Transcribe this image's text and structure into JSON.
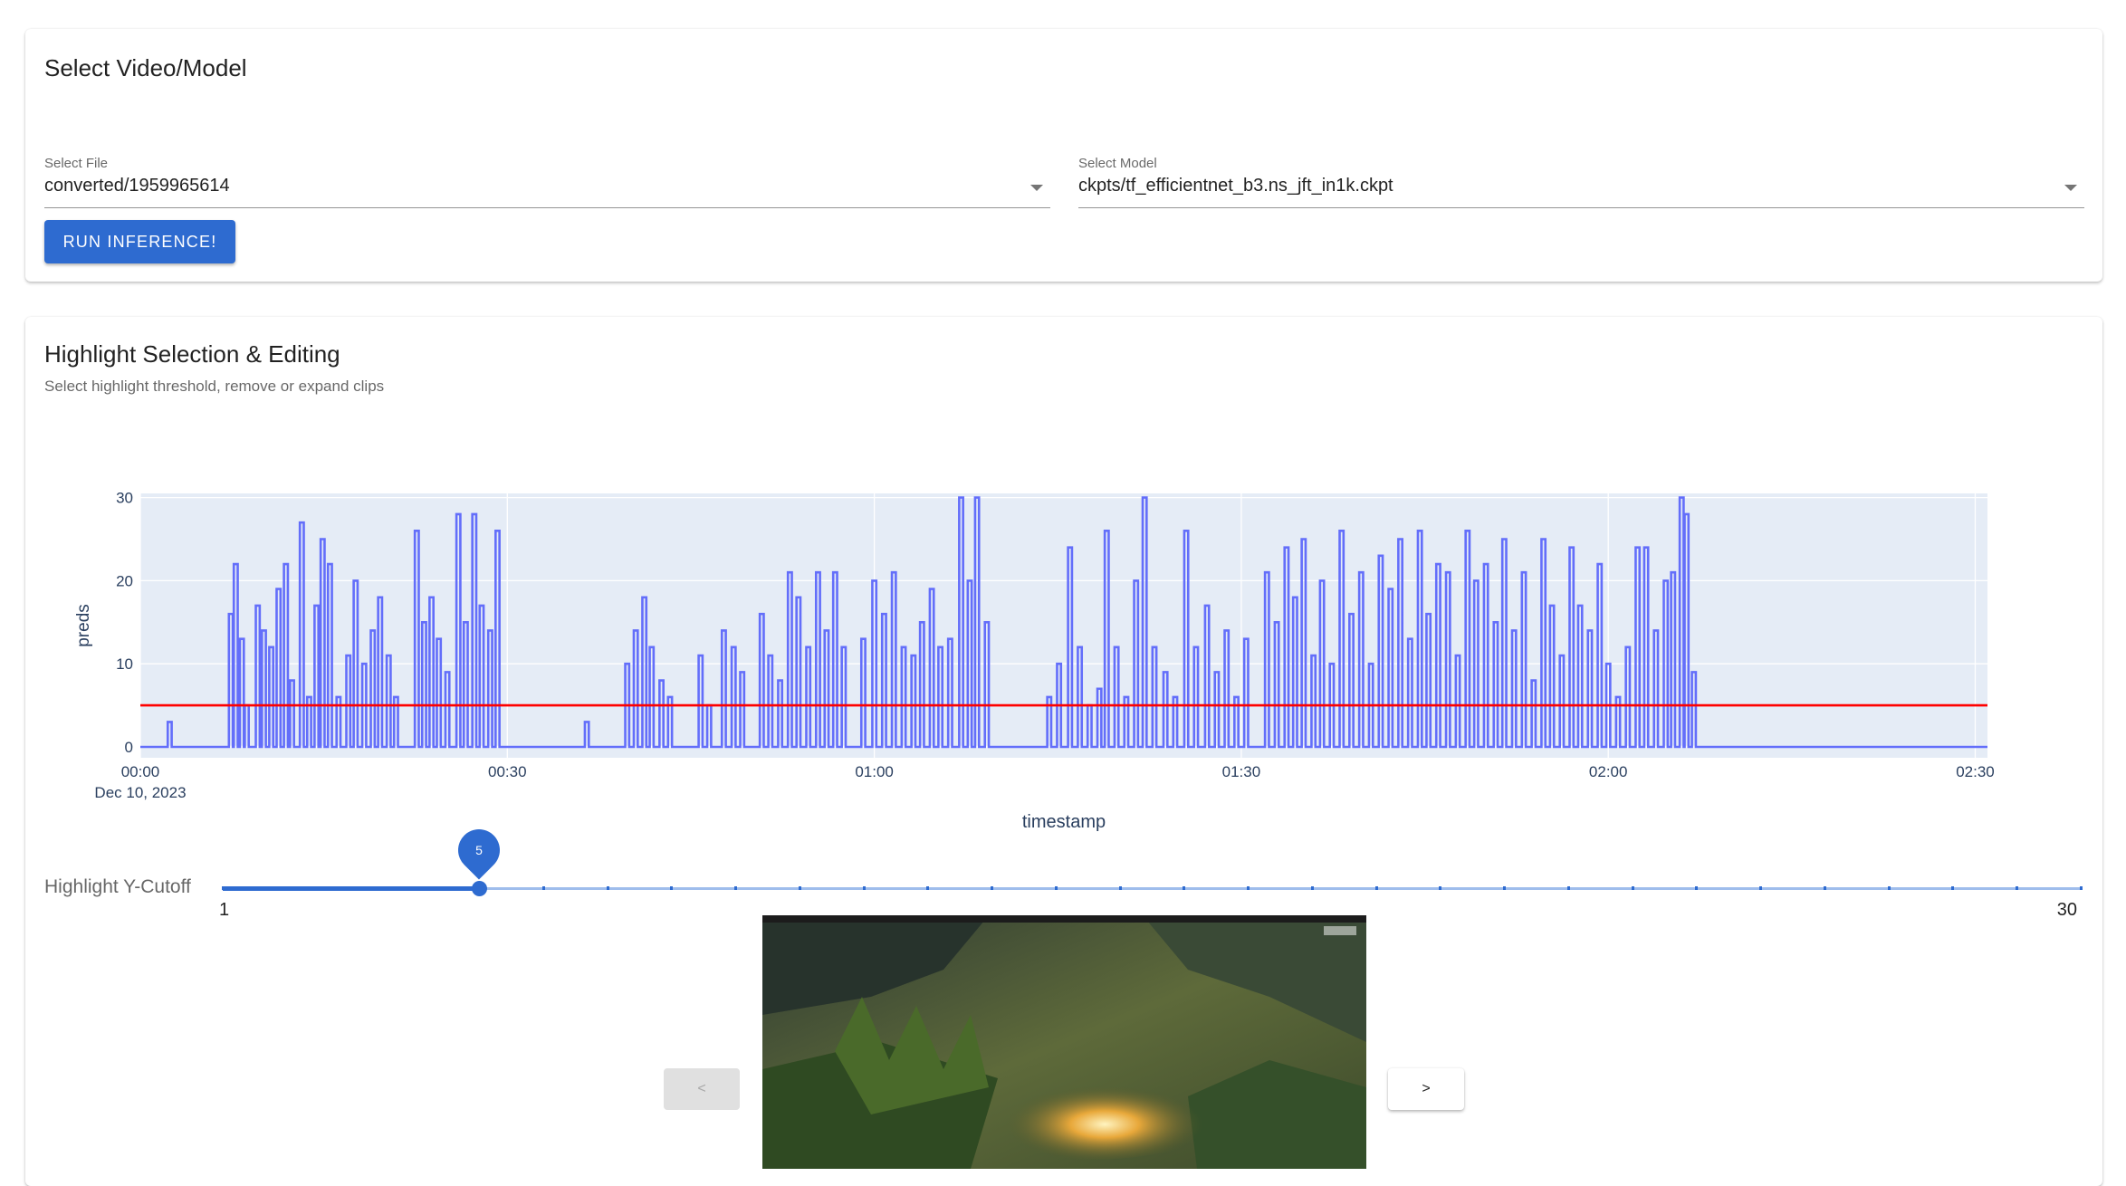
{
  "select_panel": {
    "title": "Select Video/Model",
    "file_label": "Select File",
    "file_value": "converted/1959965614",
    "model_label": "Select Model",
    "model_value": "ckpts/tf_efficientnet_b3.ns_jft_in1k.ckpt",
    "run_button": "RUN INFERENCE!"
  },
  "highlight_panel": {
    "title": "Highlight Selection & Editing",
    "subtitle": "Select highlight threshold, remove or expand clips",
    "slider_label": "Highlight Y-Cutoff",
    "slider_min": "1",
    "slider_max": "30",
    "slider_value": "5",
    "prev_button": "<",
    "next_button": ">"
  },
  "chart_data": {
    "type": "line",
    "title": "",
    "xlabel": "timestamp",
    "ylabel": "preds",
    "x_ticks": [
      "00:00",
      "00:30",
      "01:00",
      "01:30",
      "02:00",
      "02:30"
    ],
    "x_date_label": "Dec 10, 2023",
    "y_ticks": [
      "0",
      "10",
      "20",
      "30"
    ],
    "ylim": [
      0,
      30
    ],
    "xlim_seconds": [
      0,
      151
    ],
    "line_shape": "step",
    "series": [
      {
        "color": "#636efa",
        "peaks": [
          [
            2.4,
            3
          ],
          [
            7.4,
            16
          ],
          [
            7.8,
            22
          ],
          [
            8.3,
            13
          ],
          [
            8.7,
            5
          ],
          [
            9.6,
            17
          ],
          [
            10.1,
            14
          ],
          [
            10.7,
            12
          ],
          [
            11.3,
            19
          ],
          [
            11.9,
            22
          ],
          [
            12.4,
            8
          ],
          [
            13.2,
            27
          ],
          [
            13.8,
            6
          ],
          [
            14.4,
            17
          ],
          [
            14.9,
            25
          ],
          [
            15.5,
            22
          ],
          [
            16.2,
            6
          ],
          [
            17.0,
            11
          ],
          [
            17.6,
            20
          ],
          [
            18.3,
            10
          ],
          [
            19.0,
            14
          ],
          [
            19.6,
            18
          ],
          [
            20.3,
            11
          ],
          [
            20.9,
            6
          ],
          [
            22.6,
            26
          ],
          [
            23.2,
            15
          ],
          [
            23.8,
            18
          ],
          [
            24.4,
            13
          ],
          [
            25.1,
            9
          ],
          [
            26.0,
            28
          ],
          [
            26.6,
            15
          ],
          [
            27.3,
            28
          ],
          [
            27.9,
            17
          ],
          [
            28.6,
            14
          ],
          [
            29.2,
            26
          ],
          [
            36.5,
            3
          ],
          [
            39.8,
            10
          ],
          [
            40.5,
            14
          ],
          [
            41.2,
            18
          ],
          [
            41.8,
            12
          ],
          [
            42.6,
            8
          ],
          [
            43.3,
            6
          ],
          [
            45.8,
            11
          ],
          [
            46.5,
            5
          ],
          [
            47.7,
            14
          ],
          [
            48.5,
            12
          ],
          [
            49.2,
            9
          ],
          [
            50.8,
            16
          ],
          [
            51.5,
            11
          ],
          [
            52.3,
            8
          ],
          [
            53.1,
            21
          ],
          [
            53.8,
            18
          ],
          [
            54.6,
            12
          ],
          [
            55.4,
            21
          ],
          [
            56.1,
            14
          ],
          [
            56.8,
            21
          ],
          [
            57.5,
            12
          ],
          [
            59.1,
            13
          ],
          [
            60.0,
            20
          ],
          [
            60.8,
            16
          ],
          [
            61.6,
            21
          ],
          [
            62.4,
            12
          ],
          [
            63.2,
            11
          ],
          [
            63.9,
            15
          ],
          [
            64.7,
            19
          ],
          [
            65.4,
            12
          ],
          [
            66.2,
            13
          ],
          [
            67.1,
            30
          ],
          [
            67.8,
            20
          ],
          [
            68.4,
            30
          ],
          [
            69.2,
            15
          ],
          [
            74.3,
            6
          ],
          [
            75.1,
            10
          ],
          [
            76.0,
            24
          ],
          [
            76.8,
            12
          ],
          [
            77.6,
            5
          ],
          [
            78.4,
            7
          ],
          [
            79.0,
            26
          ],
          [
            79.8,
            12
          ],
          [
            80.6,
            6
          ],
          [
            81.4,
            20
          ],
          [
            82.1,
            30
          ],
          [
            82.9,
            12
          ],
          [
            83.8,
            9
          ],
          [
            84.6,
            6
          ],
          [
            85.5,
            26
          ],
          [
            86.3,
            12
          ],
          [
            87.2,
            17
          ],
          [
            88.0,
            9
          ],
          [
            88.8,
            14
          ],
          [
            89.6,
            6
          ],
          [
            90.4,
            13
          ],
          [
            92.1,
            21
          ],
          [
            92.9,
            15
          ],
          [
            93.7,
            24
          ],
          [
            94.4,
            18
          ],
          [
            95.1,
            25
          ],
          [
            95.9,
            11
          ],
          [
            96.6,
            20
          ],
          [
            97.4,
            10
          ],
          [
            98.2,
            26
          ],
          [
            99.0,
            16
          ],
          [
            99.8,
            21
          ],
          [
            100.6,
            10
          ],
          [
            101.4,
            23
          ],
          [
            102.2,
            19
          ],
          [
            103.0,
            25
          ],
          [
            103.8,
            13
          ],
          [
            104.6,
            26
          ],
          [
            105.3,
            16
          ],
          [
            106.1,
            22
          ],
          [
            106.9,
            21
          ],
          [
            107.7,
            11
          ],
          [
            108.5,
            26
          ],
          [
            109.2,
            20
          ],
          [
            110.0,
            22
          ],
          [
            110.8,
            15
          ],
          [
            111.5,
            25
          ],
          [
            112.3,
            14
          ],
          [
            113.1,
            21
          ],
          [
            113.9,
            8
          ],
          [
            114.7,
            25
          ],
          [
            115.4,
            17
          ],
          [
            116.2,
            11
          ],
          [
            117.0,
            24
          ],
          [
            117.7,
            17
          ],
          [
            118.5,
            14
          ],
          [
            119.3,
            22
          ],
          [
            120.0,
            10
          ],
          [
            120.8,
            6
          ],
          [
            121.6,
            12
          ],
          [
            122.4,
            24
          ],
          [
            123.1,
            24
          ],
          [
            123.9,
            14
          ],
          [
            124.7,
            20
          ],
          [
            125.3,
            21
          ],
          [
            126.0,
            30
          ],
          [
            126.4,
            28
          ],
          [
            127.0,
            9
          ]
        ]
      }
    ],
    "threshold": {
      "value": 5,
      "color": "#ff0000"
    }
  }
}
